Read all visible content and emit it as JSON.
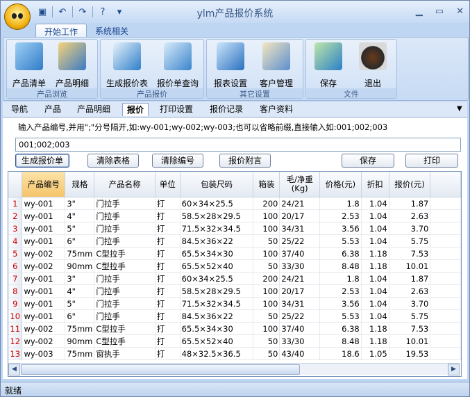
{
  "window": {
    "title": "ylm产品报价系统"
  },
  "qat": {
    "icons": [
      "save-icon",
      "undo-icon",
      "redo-icon",
      "help-icon",
      "customize-icon"
    ]
  },
  "ribbon_tabs": [
    "开始工作",
    "系统相关"
  ],
  "ribbon_groups": [
    {
      "label": "产品浏览",
      "buttons": [
        "产品清单",
        "产品明细"
      ]
    },
    {
      "label": "产品报价",
      "buttons": [
        "生成报价表",
        "报价单查询"
      ]
    },
    {
      "label": "其它设置",
      "buttons": [
        "报表设置",
        "客户管理"
      ]
    },
    {
      "label": "文件",
      "buttons": [
        "保存",
        "退出"
      ]
    }
  ],
  "doc_tabs": [
    "导航",
    "产品",
    "产品明细",
    "报价",
    "打印设置",
    "报价记录",
    "客户资料"
  ],
  "hint_text": "输入产品编号,并用\";\"分号隔开,如:wy-001;wy-002;wy-003;也可以省略前缀,直接输入如:001;002;003",
  "code_input_value": "001;002;003",
  "action_buttons": {
    "generate": "生成报价单",
    "clear_table": "清除表格",
    "clear_codes": "清除编号",
    "attach": "报价附言",
    "save": "保存",
    "print": "打印"
  },
  "table": {
    "headers": [
      "产品编号",
      "规格",
      "产品名称",
      "单位",
      "包装尺码",
      "箱装",
      "毛/净重\n(Kg)",
      "价格(元)",
      "折扣",
      "报价(元)"
    ],
    "rows": [
      [
        "1",
        "wy-001",
        "3\"",
        "门拉手",
        "打",
        "60×34×25.5",
        "200",
        "24/21",
        "1.8",
        "1.04",
        "1.87"
      ],
      [
        "2",
        "wy-001",
        "4\"",
        "门拉手",
        "打",
        "58.5×28×29.5",
        "100",
        "20/17",
        "2.53",
        "1.04",
        "2.63"
      ],
      [
        "3",
        "wy-001",
        "5\"",
        "门拉手",
        "打",
        "71.5×32×34.5",
        "100",
        "34/31",
        "3.56",
        "1.04",
        "3.70"
      ],
      [
        "4",
        "wy-001",
        "6\"",
        "门拉手",
        "打",
        "84.5×36×22",
        "50",
        "25/22",
        "5.53",
        "1.04",
        "5.75"
      ],
      [
        "5",
        "wy-002",
        "75mm",
        "C型拉手",
        "打",
        "65.5×34×30",
        "100",
        "37/40",
        "6.38",
        "1.18",
        "7.53"
      ],
      [
        "6",
        "wy-002",
        "90mm",
        "C型拉手",
        "打",
        "65.5×52×40",
        "50",
        "33/30",
        "8.48",
        "1.18",
        "10.01"
      ],
      [
        "7",
        "wy-001",
        "3\"",
        "门拉手",
        "打",
        "60×34×25.5",
        "200",
        "24/21",
        "1.8",
        "1.04",
        "1.87"
      ],
      [
        "8",
        "wy-001",
        "4\"",
        "门拉手",
        "打",
        "58.5×28×29.5",
        "100",
        "20/17",
        "2.53",
        "1.04",
        "2.63"
      ],
      [
        "9",
        "wy-001",
        "5\"",
        "门拉手",
        "打",
        "71.5×32×34.5",
        "100",
        "34/31",
        "3.56",
        "1.04",
        "3.70"
      ],
      [
        "10",
        "wy-001",
        "6\"",
        "门拉手",
        "打",
        "84.5×36×22",
        "50",
        "25/22",
        "5.53",
        "1.04",
        "5.75"
      ],
      [
        "11",
        "wy-002",
        "75mm",
        "C型拉手",
        "打",
        "65.5×34×30",
        "100",
        "37/40",
        "6.38",
        "1.18",
        "7.53"
      ],
      [
        "12",
        "wy-002",
        "90mm",
        "C型拉手",
        "打",
        "65.5×52×40",
        "50",
        "33/30",
        "8.48",
        "1.18",
        "10.01"
      ],
      [
        "13",
        "wy-003",
        "75mm",
        "窗执手",
        "打",
        "48×32.5×36.5",
        "50",
        "43/40",
        "18.6",
        "1.05",
        "19.53"
      ]
    ]
  },
  "status": {
    "text": "就绪"
  },
  "colors": {
    "accent": "#15428b",
    "row_number": "#cc0000",
    "active_header": "#f5c46a"
  }
}
